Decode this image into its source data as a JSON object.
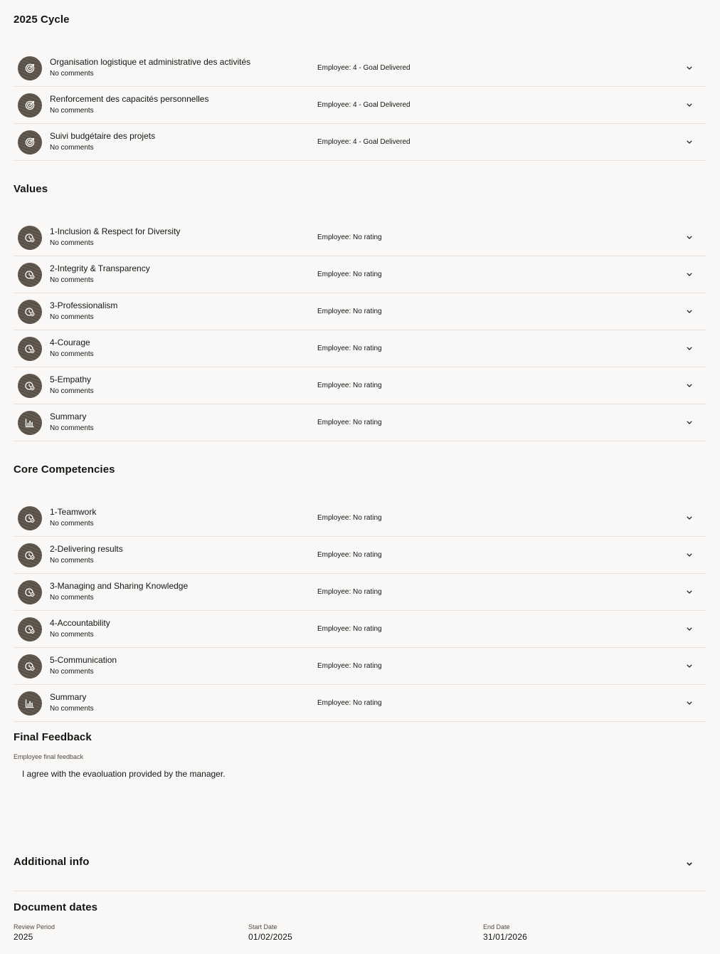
{
  "sections": {
    "cycle": {
      "title": "2025 Cycle",
      "rows": [
        {
          "title": "Organisation logistique et administrative des activités",
          "comments": "No comments",
          "rating": "Employee: 4 - Goal Delivered",
          "icon": "goal-icon"
        },
        {
          "title": "Renforcement des capacités personnelles",
          "comments": "No comments",
          "rating": "Employee: 4 - Goal Delivered",
          "icon": "goal-icon"
        },
        {
          "title": "Suivi budgétaire des projets",
          "comments": "No comments",
          "rating": "Employee: 4 - Goal Delivered",
          "icon": "goal-icon"
        }
      ]
    },
    "values": {
      "title": "Values",
      "rows": [
        {
          "title": "1-Inclusion & Respect for Diversity",
          "comments": "No comments",
          "rating": "Employee: No rating",
          "icon": "competency-icon"
        },
        {
          "title": "2-Integrity & Transparency",
          "comments": "No comments",
          "rating": "Employee: No rating",
          "icon": "competency-icon"
        },
        {
          "title": "3-Professionalism",
          "comments": "No comments",
          "rating": "Employee: No rating",
          "icon": "competency-icon"
        },
        {
          "title": "4-Courage",
          "comments": "No comments",
          "rating": "Employee: No rating",
          "icon": "competency-icon"
        },
        {
          "title": "5-Empathy",
          "comments": "No comments",
          "rating": "Employee: No rating",
          "icon": "competency-icon"
        },
        {
          "title": "Summary",
          "comments": "No comments",
          "rating": "Employee: No rating",
          "icon": "summary-chart-icon"
        }
      ]
    },
    "core": {
      "title": "Core Competencies",
      "rows": [
        {
          "title": "1-Teamwork",
          "comments": "No comments",
          "rating": "Employee: No rating",
          "icon": "competency-icon"
        },
        {
          "title": "2-Delivering results",
          "comments": "No comments",
          "rating": "Employee: No rating",
          "icon": "competency-icon"
        },
        {
          "title": "3-Managing and Sharing Knowledge",
          "comments": "No comments",
          "rating": "Employee: No rating",
          "icon": "competency-icon"
        },
        {
          "title": "4-Accountability",
          "comments": "No comments",
          "rating": "Employee: No rating",
          "icon": "competency-icon"
        },
        {
          "title": "5-Communication",
          "comments": "No comments",
          "rating": "Employee: No rating",
          "icon": "competency-icon"
        },
        {
          "title": "Summary",
          "comments": "No comments",
          "rating": "Employee: No rating",
          "icon": "summary-chart-icon"
        }
      ]
    }
  },
  "final_feedback": {
    "title": "Final Feedback",
    "label": "Employee final feedback",
    "text": "I agree with the evaoluation provided by the manager."
  },
  "additional_info": {
    "title": "Additional info"
  },
  "document_dates": {
    "title": "Document dates",
    "review_period_label": "Review Period",
    "review_period_value": "2025",
    "start_date_label": "Start Date",
    "start_date_value": "01/02/2025",
    "end_date_label": "End Date",
    "end_date_value": "31/01/2026"
  },
  "colors": {
    "background": "#f9f8f6",
    "avatar": "#5b5348",
    "divider": "#e3e0db"
  }
}
